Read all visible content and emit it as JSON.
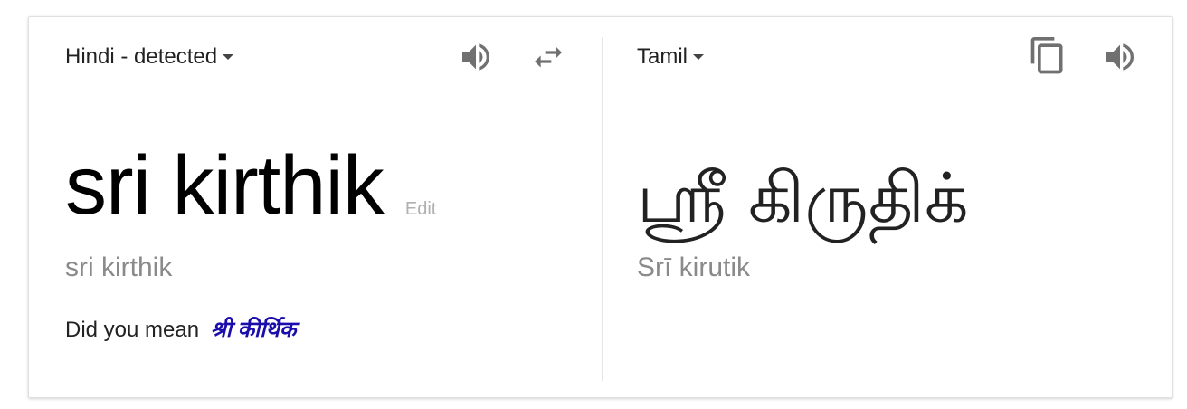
{
  "source": {
    "language_label": "Hindi - detected",
    "text": "sri kirthik",
    "edit_label": "Edit",
    "transliteration": "sri kirthik",
    "did_you_mean_label": "Did you mean",
    "suggestion": "श्री कीर्थिक"
  },
  "target": {
    "language_label": "Tamil",
    "text": "ஸ்ரீ கிருதிக்",
    "transliteration": "Srī kirutik"
  },
  "icons": {
    "source_speaker": "speaker-icon",
    "swap": "swap-languages-icon",
    "copy": "copy-icon",
    "target_speaker": "speaker-icon"
  },
  "colors": {
    "icon": "#707070",
    "suggestion_link": "#1a0dab",
    "muted_text": "#8a8a8a"
  }
}
